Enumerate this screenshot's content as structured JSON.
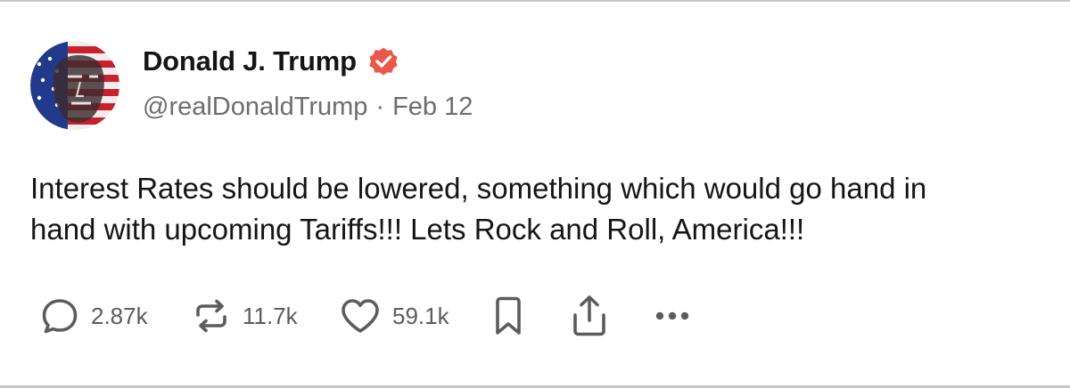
{
  "post": {
    "author": {
      "display_name": "Donald J. Trump",
      "handle": "@realDonaldTrump",
      "verified": true,
      "verified_color": "#e8594a"
    },
    "separator": "·",
    "date": "Feb 12",
    "text_lines": [
      "Interest Rates should be lowered, something which would go hand in",
      "hand with upcoming Tariffs!!! Lets Rock and Roll, America!!!"
    ],
    "actions": {
      "replies": {
        "icon": "reply-icon",
        "count": "2.87k"
      },
      "reposts": {
        "icon": "repost-icon",
        "count": "11.7k"
      },
      "likes": {
        "icon": "heart-icon",
        "count": "59.1k"
      },
      "bookmark": {
        "icon": "bookmark-icon"
      },
      "share": {
        "icon": "share-icon"
      },
      "more": {
        "icon": "more-icon"
      }
    }
  },
  "colors": {
    "text_primary": "#151515",
    "text_secondary": "#6d6d6d",
    "icon_gray": "#5c5c5c"
  }
}
